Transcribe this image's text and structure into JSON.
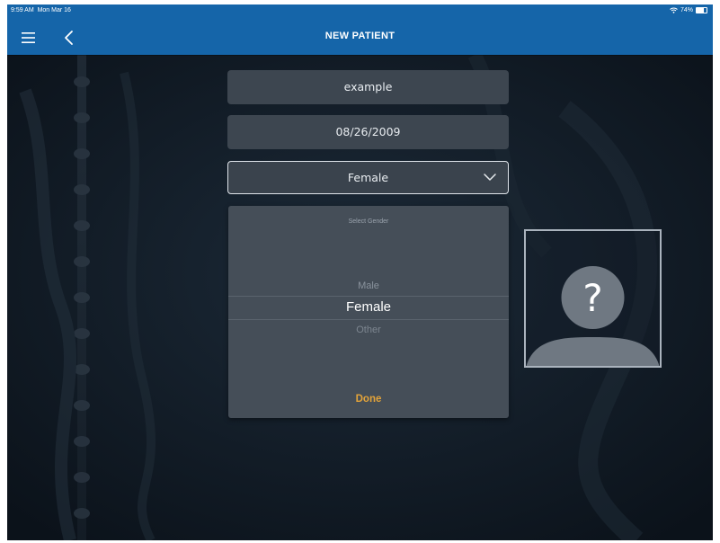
{
  "status_bar": {
    "time": "9:59 AM",
    "date": "Mon Mar 16",
    "battery": "74%",
    "battery_level": 0.74
  },
  "nav": {
    "title": "NEW PATIENT",
    "menu_icon": "hamburger-menu-icon",
    "back_icon": "chevron-left-icon"
  },
  "form": {
    "name_value": "example",
    "dob_value": "08/26/2009",
    "gender_value": "Female",
    "gender_icon": "chevron-down-icon"
  },
  "picker": {
    "header": "Select Gender",
    "options": [
      "Male",
      "Female",
      "Other"
    ],
    "selected": "Female",
    "done_label": "Done"
  },
  "avatar": {
    "placeholder_glyph": "?",
    "icon": "user-placeholder-icon"
  },
  "colors": {
    "nav_blue": "#1565a9",
    "field_bg": "#3d4650",
    "picker_bg": "#454e58",
    "accent_orange": "#e2a33a"
  }
}
